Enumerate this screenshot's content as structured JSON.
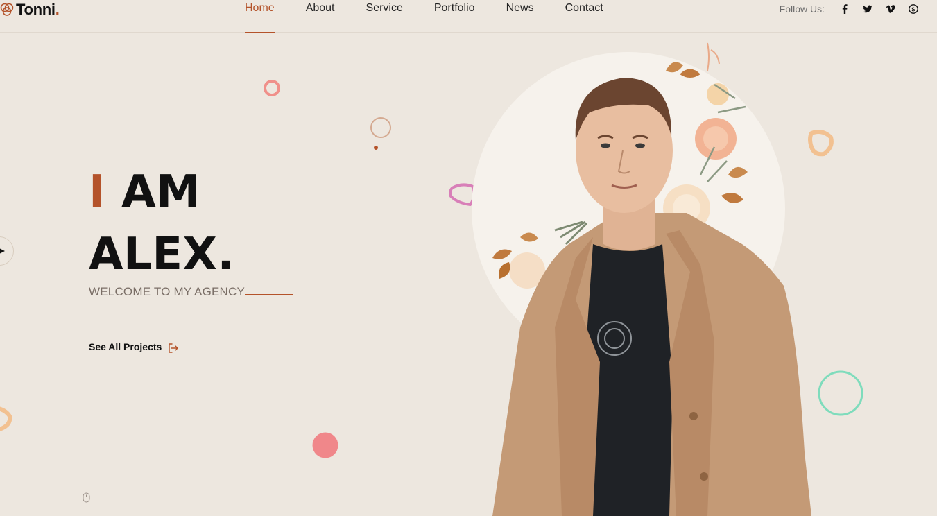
{
  "header": {
    "logo_text": "Tonni",
    "logo_dot": ".",
    "nav": [
      {
        "label": "Home",
        "active": true
      },
      {
        "label": "About",
        "active": false
      },
      {
        "label": "Service",
        "active": false
      },
      {
        "label": "Portfolio",
        "active": false
      },
      {
        "label": "News",
        "active": false
      },
      {
        "label": "Contact",
        "active": false
      }
    ],
    "follow_label": "Follow Us:",
    "social": [
      "facebook-icon",
      "twitter-icon",
      "vimeo-icon",
      "skype-icon"
    ]
  },
  "hero": {
    "title_accent": "I",
    "title_line1_rest": "AM",
    "title_line2": "ALEX.",
    "subtitle": "WELCOME TO MY AGENCY",
    "cta_label": "See All Projects"
  },
  "colors": {
    "background": "#ede7df",
    "accent": "#b4532a",
    "portrait_circle": "#f6f2ec",
    "jacket": "#c49a76",
    "shirt": "#1f2226"
  }
}
